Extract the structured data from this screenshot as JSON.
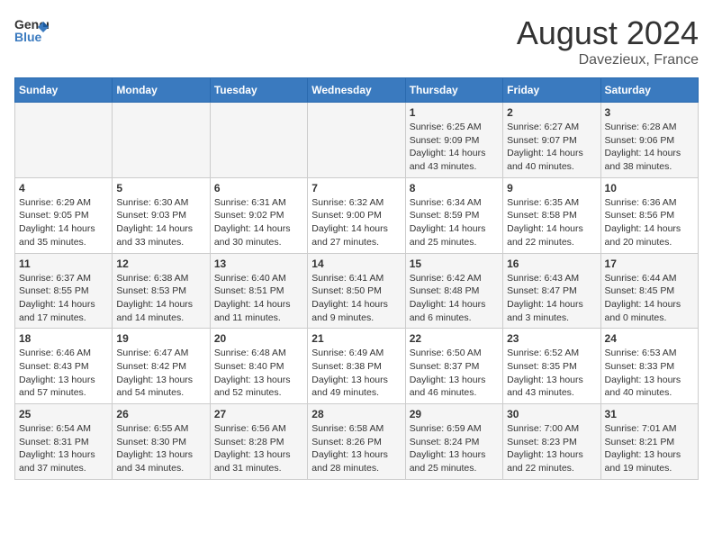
{
  "header": {
    "logo_general": "General",
    "logo_blue": "Blue",
    "month": "August 2024",
    "location": "Davezieux, France"
  },
  "days_of_week": [
    "Sunday",
    "Monday",
    "Tuesday",
    "Wednesday",
    "Thursday",
    "Friday",
    "Saturday"
  ],
  "weeks": [
    [
      {
        "day": "",
        "info": ""
      },
      {
        "day": "",
        "info": ""
      },
      {
        "day": "",
        "info": ""
      },
      {
        "day": "",
        "info": ""
      },
      {
        "day": "1",
        "info": "Sunrise: 6:25 AM\nSunset: 9:09 PM\nDaylight: 14 hours\nand 43 minutes."
      },
      {
        "day": "2",
        "info": "Sunrise: 6:27 AM\nSunset: 9:07 PM\nDaylight: 14 hours\nand 40 minutes."
      },
      {
        "day": "3",
        "info": "Sunrise: 6:28 AM\nSunset: 9:06 PM\nDaylight: 14 hours\nand 38 minutes."
      }
    ],
    [
      {
        "day": "4",
        "info": "Sunrise: 6:29 AM\nSunset: 9:05 PM\nDaylight: 14 hours\nand 35 minutes."
      },
      {
        "day": "5",
        "info": "Sunrise: 6:30 AM\nSunset: 9:03 PM\nDaylight: 14 hours\nand 33 minutes."
      },
      {
        "day": "6",
        "info": "Sunrise: 6:31 AM\nSunset: 9:02 PM\nDaylight: 14 hours\nand 30 minutes."
      },
      {
        "day": "7",
        "info": "Sunrise: 6:32 AM\nSunset: 9:00 PM\nDaylight: 14 hours\nand 27 minutes."
      },
      {
        "day": "8",
        "info": "Sunrise: 6:34 AM\nSunset: 8:59 PM\nDaylight: 14 hours\nand 25 minutes."
      },
      {
        "day": "9",
        "info": "Sunrise: 6:35 AM\nSunset: 8:58 PM\nDaylight: 14 hours\nand 22 minutes."
      },
      {
        "day": "10",
        "info": "Sunrise: 6:36 AM\nSunset: 8:56 PM\nDaylight: 14 hours\nand 20 minutes."
      }
    ],
    [
      {
        "day": "11",
        "info": "Sunrise: 6:37 AM\nSunset: 8:55 PM\nDaylight: 14 hours\nand 17 minutes."
      },
      {
        "day": "12",
        "info": "Sunrise: 6:38 AM\nSunset: 8:53 PM\nDaylight: 14 hours\nand 14 minutes."
      },
      {
        "day": "13",
        "info": "Sunrise: 6:40 AM\nSunset: 8:51 PM\nDaylight: 14 hours\nand 11 minutes."
      },
      {
        "day": "14",
        "info": "Sunrise: 6:41 AM\nSunset: 8:50 PM\nDaylight: 14 hours\nand 9 minutes."
      },
      {
        "day": "15",
        "info": "Sunrise: 6:42 AM\nSunset: 8:48 PM\nDaylight: 14 hours\nand 6 minutes."
      },
      {
        "day": "16",
        "info": "Sunrise: 6:43 AM\nSunset: 8:47 PM\nDaylight: 14 hours\nand 3 minutes."
      },
      {
        "day": "17",
        "info": "Sunrise: 6:44 AM\nSunset: 8:45 PM\nDaylight: 14 hours\nand 0 minutes."
      }
    ],
    [
      {
        "day": "18",
        "info": "Sunrise: 6:46 AM\nSunset: 8:43 PM\nDaylight: 13 hours\nand 57 minutes."
      },
      {
        "day": "19",
        "info": "Sunrise: 6:47 AM\nSunset: 8:42 PM\nDaylight: 13 hours\nand 54 minutes."
      },
      {
        "day": "20",
        "info": "Sunrise: 6:48 AM\nSunset: 8:40 PM\nDaylight: 13 hours\nand 52 minutes."
      },
      {
        "day": "21",
        "info": "Sunrise: 6:49 AM\nSunset: 8:38 PM\nDaylight: 13 hours\nand 49 minutes."
      },
      {
        "day": "22",
        "info": "Sunrise: 6:50 AM\nSunset: 8:37 PM\nDaylight: 13 hours\nand 46 minutes."
      },
      {
        "day": "23",
        "info": "Sunrise: 6:52 AM\nSunset: 8:35 PM\nDaylight: 13 hours\nand 43 minutes."
      },
      {
        "day": "24",
        "info": "Sunrise: 6:53 AM\nSunset: 8:33 PM\nDaylight: 13 hours\nand 40 minutes."
      }
    ],
    [
      {
        "day": "25",
        "info": "Sunrise: 6:54 AM\nSunset: 8:31 PM\nDaylight: 13 hours\nand 37 minutes."
      },
      {
        "day": "26",
        "info": "Sunrise: 6:55 AM\nSunset: 8:30 PM\nDaylight: 13 hours\nand 34 minutes."
      },
      {
        "day": "27",
        "info": "Sunrise: 6:56 AM\nSunset: 8:28 PM\nDaylight: 13 hours\nand 31 minutes."
      },
      {
        "day": "28",
        "info": "Sunrise: 6:58 AM\nSunset: 8:26 PM\nDaylight: 13 hours\nand 28 minutes."
      },
      {
        "day": "29",
        "info": "Sunrise: 6:59 AM\nSunset: 8:24 PM\nDaylight: 13 hours\nand 25 minutes."
      },
      {
        "day": "30",
        "info": "Sunrise: 7:00 AM\nSunset: 8:23 PM\nDaylight: 13 hours\nand 22 minutes."
      },
      {
        "day": "31",
        "info": "Sunrise: 7:01 AM\nSunset: 8:21 PM\nDaylight: 13 hours\nand 19 minutes."
      }
    ]
  ]
}
